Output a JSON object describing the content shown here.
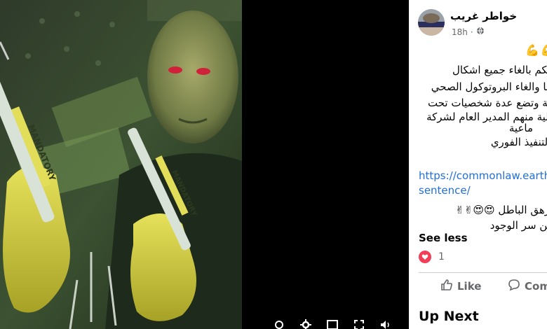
{
  "post": {
    "author": "خواطر غريب",
    "time": "18h",
    "emojis": [
      "💪",
      "💪"
    ],
    "lines": [
      "حكم بالغاء جميع اشكال",
      "بها والغاء البروتوكول الصحي",
      "بية وتضع عدة شخصيات تحت",
      "ولية منهم المدير العام لشركة",
      "ماعية",
      "بالتنفيذ الفوري"
    ],
    "link_line1": "https://commonlaw.earth/i",
    "link_line2": "sentence/",
    "closing_line1": "زهق الباطل 😍😍✌✌",
    "closing_line2": "حن سر الوجود",
    "see_less": "See less",
    "reaction_count": "1",
    "like_label": "Like",
    "comment_label": "Com",
    "up_next": "Up Next"
  },
  "media": {
    "poster_text": [
      "MANDATORY",
      "MANDATORY"
    ]
  },
  "colors": {
    "link": "#216fdb",
    "heart": "#f33e58",
    "secondary_text": "#65676b"
  }
}
